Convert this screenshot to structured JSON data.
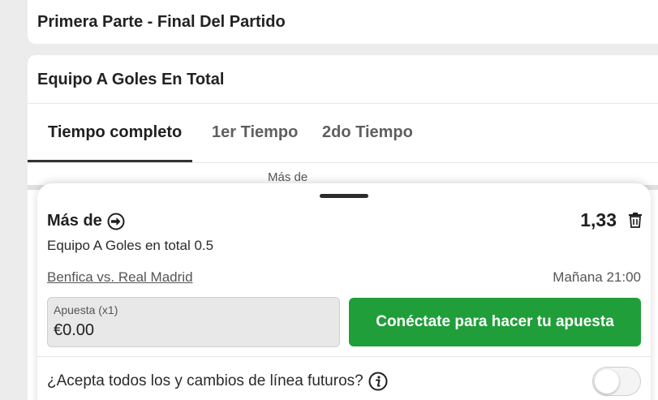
{
  "sections": {
    "first": {
      "title": "Primera Parte - Final Del Partido"
    },
    "second": {
      "title": "Equipo A Goles En Total"
    }
  },
  "tabs": [
    {
      "label": "Tiempo completo",
      "active": true
    },
    {
      "label": "1er Tiempo",
      "active": false
    },
    {
      "label": "2do Tiempo",
      "active": false
    }
  ],
  "column_header": "Más de",
  "betslip": {
    "selection": "Más de",
    "odds": "1,33",
    "market": "Equipo A Goles en total 0.5",
    "event": "Benfica vs. Real Madrid",
    "event_time": "Mañana 21:00",
    "stake_label": "Apuesta (x1)",
    "stake_value": "€0.00",
    "cta_label": "Conéctate para hacer tu apuesta",
    "accept_changes_label": "¿Acepta todos los y cambios de línea futuros?",
    "accept_changes_enabled": false
  },
  "colors": {
    "cta": "#1f9e3a",
    "background": "#ececec"
  },
  "icons": {
    "selection": "arrow-right-circle-icon",
    "remove": "trash-icon",
    "info": "info-icon"
  }
}
